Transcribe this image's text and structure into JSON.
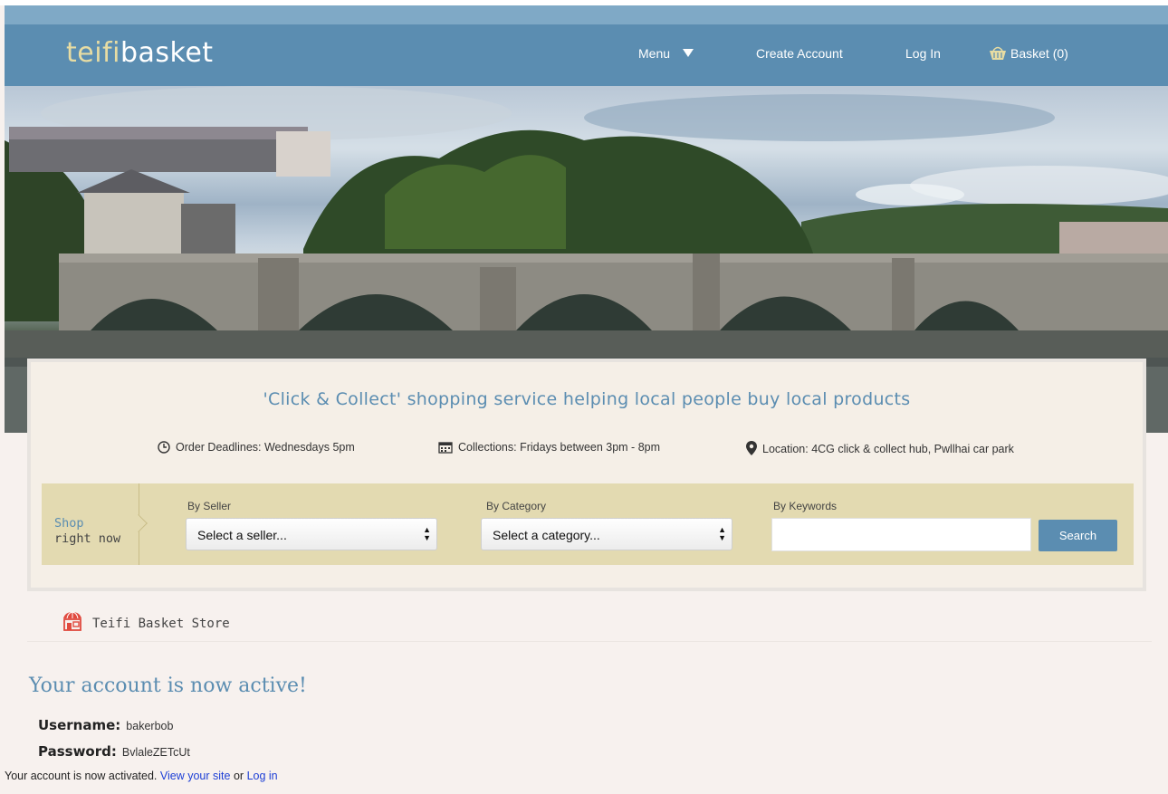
{
  "brand": {
    "part1": "teifi",
    "part2": "basket"
  },
  "nav": {
    "menu_label": "Menu",
    "create_account": "Create Account",
    "login": "Log In",
    "basket": "Basket (0)"
  },
  "hero": {
    "tagline": "'Click & Collect' shopping service helping local people buy local products",
    "order_deadline": "Order Deadlines: Wednesdays 5pm",
    "collections": "Collections: Fridays between 3pm - 8pm",
    "location": "Location: 4CG click & collect hub, Pwllhai car park"
  },
  "shop": {
    "label_line1": "Shop",
    "label_line2": "right now",
    "seller_label": "By Seller",
    "seller_value": "Select a seller...",
    "category_label": "By Category",
    "category_value": "Select a category...",
    "keywords_label": "By Keywords",
    "keywords_value": "",
    "search_button": "Search"
  },
  "store": {
    "name": "Teifi Basket Store"
  },
  "account": {
    "heading": "Your account is now active!",
    "username_label": "Username:",
    "username_value": "bakerbob",
    "password_label": "Password:",
    "password_value": "BvlaleZETcUt",
    "activated_text": "Your account is now activated.",
    "view_site_link": "View your site",
    "or_text": "or",
    "login_link": "Log in"
  },
  "colors": {
    "nav_bg": "#5b8db1",
    "accent_yellow": "#e7dca3",
    "shopbar_bg": "#e3dab1",
    "link_blue": "#1d3fd6"
  }
}
